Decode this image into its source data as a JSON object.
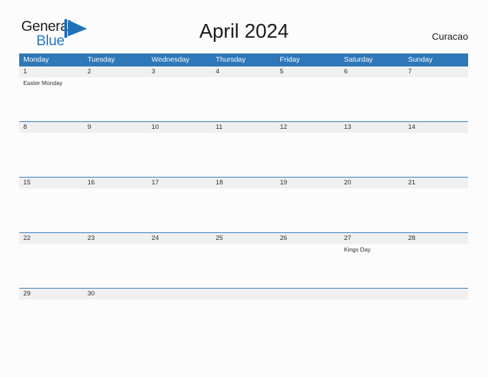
{
  "brand": {
    "name_part1": "General",
    "name_part2": "Blue",
    "flag_icon": "blue-flag-triangle-icon",
    "color_primary": "#2277c4",
    "color_text": "#1c1c1c"
  },
  "header": {
    "title": "April 2024",
    "region": "Curacao"
  },
  "theme": {
    "header_blue": "#2e77b8",
    "date_band_gray": "#f0f0f0",
    "page_background": "#fcfcfc",
    "text_dark": "#2b2b2b"
  },
  "calendar": {
    "weekdays": [
      "Monday",
      "Tuesday",
      "Wednesday",
      "Thursday",
      "Friday",
      "Saturday",
      "Sunday"
    ],
    "weeks": [
      {
        "days": [
          {
            "date": "1",
            "events": [
              "Easter Monday"
            ]
          },
          {
            "date": "2",
            "events": []
          },
          {
            "date": "3",
            "events": []
          },
          {
            "date": "4",
            "events": []
          },
          {
            "date": "5",
            "events": []
          },
          {
            "date": "6",
            "events": []
          },
          {
            "date": "7",
            "events": []
          }
        ]
      },
      {
        "days": [
          {
            "date": "8",
            "events": []
          },
          {
            "date": "9",
            "events": []
          },
          {
            "date": "10",
            "events": []
          },
          {
            "date": "11",
            "events": []
          },
          {
            "date": "12",
            "events": []
          },
          {
            "date": "13",
            "events": []
          },
          {
            "date": "14",
            "events": []
          }
        ]
      },
      {
        "days": [
          {
            "date": "15",
            "events": []
          },
          {
            "date": "16",
            "events": []
          },
          {
            "date": "17",
            "events": []
          },
          {
            "date": "18",
            "events": []
          },
          {
            "date": "19",
            "events": []
          },
          {
            "date": "20",
            "events": []
          },
          {
            "date": "21",
            "events": []
          }
        ]
      },
      {
        "days": [
          {
            "date": "22",
            "events": []
          },
          {
            "date": "23",
            "events": []
          },
          {
            "date": "24",
            "events": []
          },
          {
            "date": "25",
            "events": []
          },
          {
            "date": "26",
            "events": []
          },
          {
            "date": "27",
            "events": [
              "Kings Day"
            ]
          },
          {
            "date": "28",
            "events": []
          }
        ]
      },
      {
        "days": [
          {
            "date": "29",
            "events": []
          },
          {
            "date": "30",
            "events": []
          },
          {
            "date": "",
            "events": []
          },
          {
            "date": "",
            "events": []
          },
          {
            "date": "",
            "events": []
          },
          {
            "date": "",
            "events": []
          },
          {
            "date": "",
            "events": []
          }
        ]
      }
    ]
  }
}
